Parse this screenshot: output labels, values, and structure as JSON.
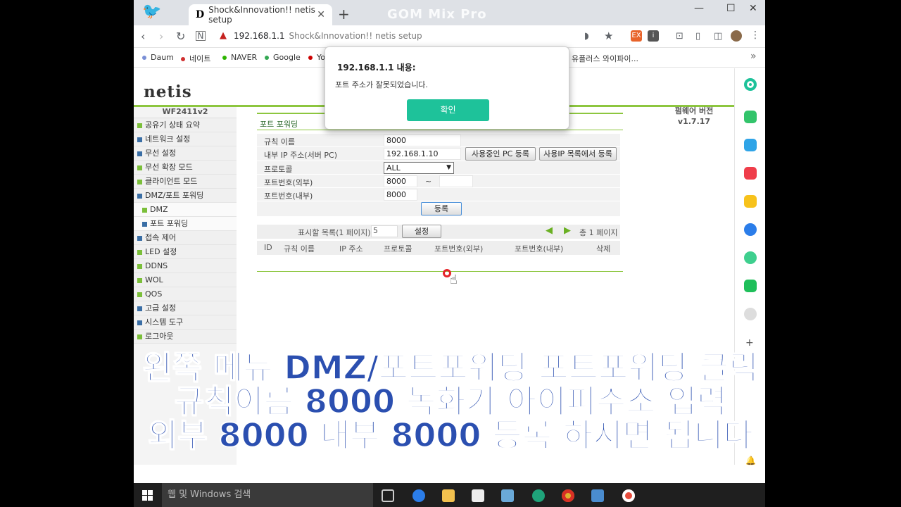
{
  "browser": {
    "tab_title": "Shock&Innovation!! netis setup",
    "tab_favicon": "D",
    "watermark": "GOM Mix Pro",
    "url": "192.168.1.1",
    "page_title": "Shock&Innovation!! netis setup",
    "bookmarks": [
      "Daum",
      "네이트",
      "NAVER",
      "Google",
      "Yo",
      "유플러스 와이파이..."
    ],
    "bookmark_colors": [
      "#7a8fd6",
      "#d03030",
      "#2db400",
      "#34a853",
      "#cc0000",
      "#2b7de9"
    ],
    "more_bookmarks": "»"
  },
  "router": {
    "logo": "netis",
    "model": "WF2411v2",
    "firmware_label": "펌웨어 버전",
    "firmware_version": "v1.7.17",
    "menu": [
      {
        "label": "공유기 상태 요약",
        "type": "main"
      },
      {
        "label": "네트워크 설정",
        "type": "main"
      },
      {
        "label": "무선 설정",
        "type": "main"
      },
      {
        "label": "무선 확장 모드",
        "type": "main"
      },
      {
        "label": "클라이언트 모드",
        "type": "main"
      },
      {
        "label": "DMZ/포트 포워딩",
        "type": "open"
      },
      {
        "label": "DMZ",
        "type": "sub"
      },
      {
        "label": "포트 포워딩",
        "type": "sub-active"
      },
      {
        "label": "접속 제어",
        "type": "main"
      },
      {
        "label": "LED 설정",
        "type": "main"
      },
      {
        "label": "DDNS",
        "type": "main"
      },
      {
        "label": "WOL",
        "type": "main"
      },
      {
        "label": "QOS",
        "type": "main"
      },
      {
        "label": "고급 설정",
        "type": "main"
      },
      {
        "label": "시스템 도구",
        "type": "main"
      },
      {
        "label": "로그아웃",
        "type": "main"
      }
    ],
    "section_title": "포트 포워딩",
    "form": {
      "rule_name_label": "규칙 이름",
      "rule_name_value": "8000",
      "internal_ip_label": "내부 IP 주소(서버 PC)",
      "internal_ip_value": "192.168.1.10",
      "btn_register_current_pc": "사용중인 PC 등록",
      "btn_register_from_list": "사용IP 목록에서 등록",
      "protocol_label": "프로토콜",
      "protocol_value": "ALL",
      "ext_port_label": "포트번호(외부)",
      "ext_port_value": "8000",
      "ext_port_sep": "~",
      "ext_port_end": "",
      "int_port_label": "포트번호(내부)",
      "int_port_value": "8000",
      "register_button": "등록"
    },
    "list": {
      "display_label": "표시할 목록(1 페이지)",
      "display_value": "5",
      "set_button": "설정",
      "page_info": "총 1 페이지",
      "columns": [
        "ID",
        "규칙 이름",
        "IP 주소",
        "프로토콜",
        "포트번호(외부)",
        "포트번호(내부)",
        "삭제"
      ]
    }
  },
  "dialog": {
    "title": "192.168.1.1 내용:",
    "message": "포트 주소가 잘못되었습니다.",
    "ok_button": "확인"
  },
  "subtitles": [
    "왼쪽 메뉴 DMZ/포트포워딩 포트포워딩 클릭",
    "규칙이름 8000 녹화기 아이피주소 입력",
    "외부 8000 내부 8000 등록 하시면 됩니다"
  ],
  "taskbar": {
    "search_placeholder": "웹 및 Windows 검색"
  }
}
